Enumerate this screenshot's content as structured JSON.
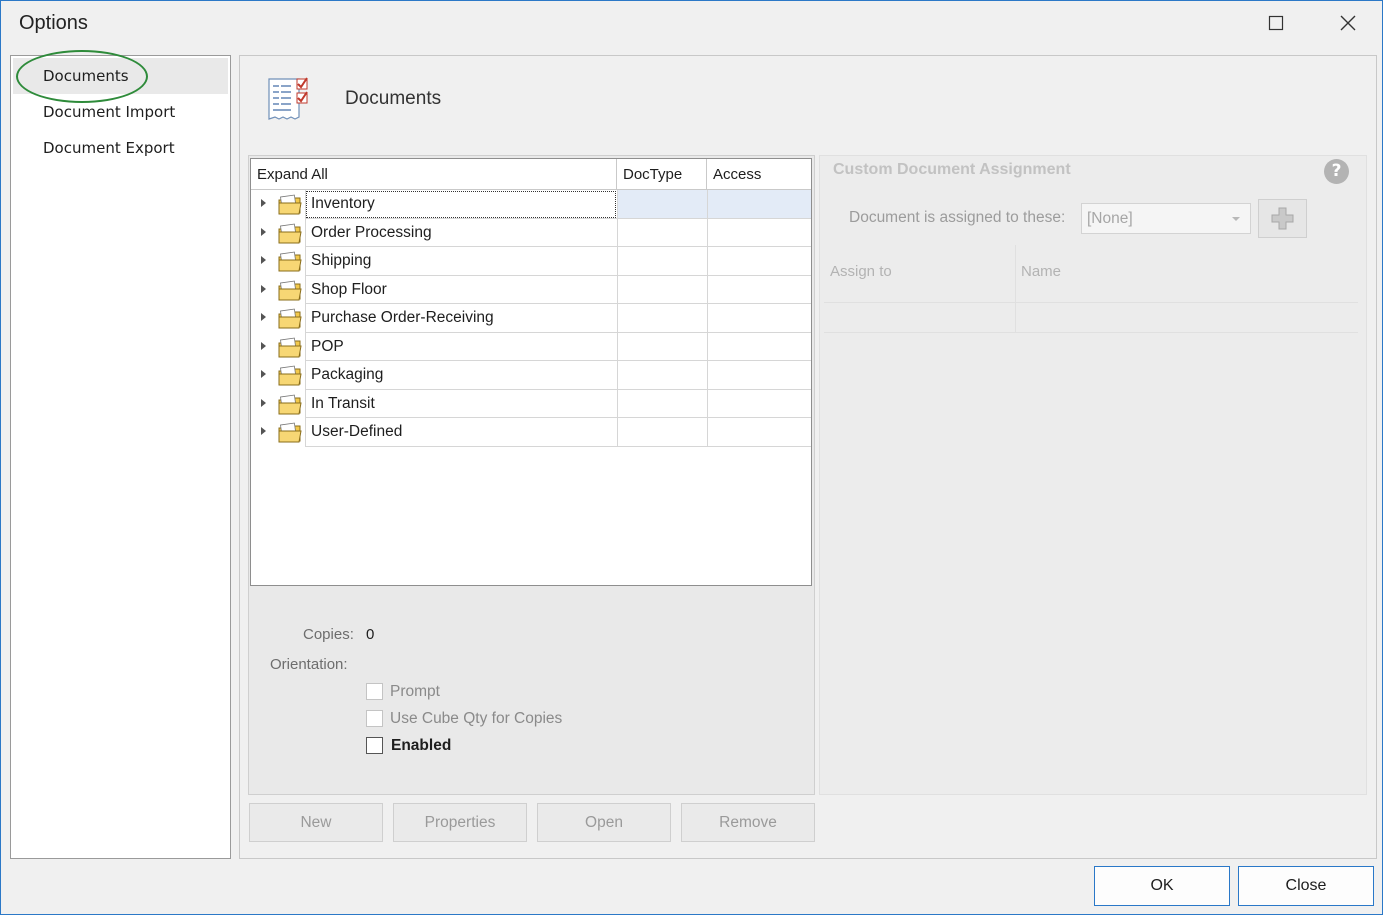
{
  "window": {
    "title": "Options"
  },
  "nav": {
    "items": [
      {
        "label": "Documents",
        "selected": true
      },
      {
        "label": "Document Import",
        "selected": false
      },
      {
        "label": "Document Export",
        "selected": false
      }
    ]
  },
  "main": {
    "title": "Documents",
    "icon": "document-checklist-icon"
  },
  "tree": {
    "columns": [
      "Expand All",
      "DocType",
      "Access"
    ],
    "rows": [
      {
        "label": "Inventory",
        "focused": true
      },
      {
        "label": "Order Processing"
      },
      {
        "label": "Shipping"
      },
      {
        "label": "Shop Floor"
      },
      {
        "label": "Purchase Order-Receiving"
      },
      {
        "label": "POP"
      },
      {
        "label": "Packaging"
      },
      {
        "label": "In Transit"
      },
      {
        "label": "User-Defined"
      }
    ]
  },
  "properties": {
    "copies_label": "Copies:",
    "copies_value": "0",
    "orientation_label": "Orientation:",
    "prompt_label": "Prompt",
    "cube_label": "Use Cube Qty  for Copies",
    "enabled_label": "Enabled"
  },
  "buttons": {
    "new": "New",
    "properties": "Properties",
    "open": "Open",
    "remove": "Remove",
    "ok": "OK",
    "close": "Close"
  },
  "custom": {
    "title": "Custom Document Assignment",
    "help": "?",
    "assigned_label": "Document is assigned to these:",
    "assigned_value": "[None]",
    "grid_headers": [
      "Assign to",
      "Name"
    ]
  },
  "colors": {
    "accent": "#2a78c8",
    "highlight_ellipse": "#2e8b3a"
  }
}
